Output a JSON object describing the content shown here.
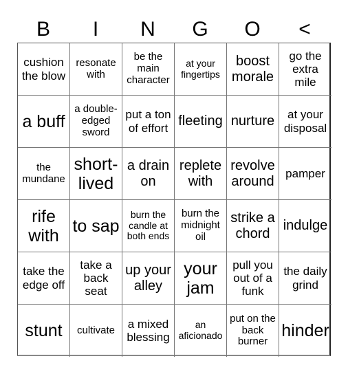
{
  "header": {
    "letters": [
      "B",
      "I",
      "N",
      "G",
      "O",
      "<"
    ]
  },
  "board": {
    "cells": [
      {
        "text": "cushion the blow",
        "size": "m"
      },
      {
        "text": "resonate with",
        "size": "s"
      },
      {
        "text": "be the main character",
        "size": "s"
      },
      {
        "text": "at your fingertips",
        "size": "xs"
      },
      {
        "text": "boost morale",
        "size": "l"
      },
      {
        "text": "go the extra mile",
        "size": "m"
      },
      {
        "text": "a buff",
        "size": "xl"
      },
      {
        "text": "a double-edged sword",
        "size": "s"
      },
      {
        "text": "put a ton of effort",
        "size": "m"
      },
      {
        "text": "fleeting",
        "size": "l"
      },
      {
        "text": "nurture",
        "size": "l"
      },
      {
        "text": "at your disposal",
        "size": "m"
      },
      {
        "text": "the mundane",
        "size": "s"
      },
      {
        "text": "short-lived",
        "size": "xl"
      },
      {
        "text": "a drain on",
        "size": "l"
      },
      {
        "text": "replete with",
        "size": "l"
      },
      {
        "text": "revolve around",
        "size": "l"
      },
      {
        "text": "pamper",
        "size": "m"
      },
      {
        "text": "rife with",
        "size": "xl"
      },
      {
        "text": "to sap",
        "size": "xl"
      },
      {
        "text": "burn the candle at both ends",
        "size": "xs"
      },
      {
        "text": "burn the midnight oil",
        "size": "s"
      },
      {
        "text": "strike a chord",
        "size": "l"
      },
      {
        "text": "indulge",
        "size": "l"
      },
      {
        "text": "take the edge off",
        "size": "m"
      },
      {
        "text": "take a back seat",
        "size": "m"
      },
      {
        "text": "up your alley",
        "size": "l"
      },
      {
        "text": "your jam",
        "size": "xl"
      },
      {
        "text": "pull you out of a funk",
        "size": "m"
      },
      {
        "text": "the daily grind",
        "size": "m"
      },
      {
        "text": "stunt",
        "size": "xl"
      },
      {
        "text": "cultivate",
        "size": "s"
      },
      {
        "text": "a mixed blessing",
        "size": "m"
      },
      {
        "text": "an aficionado",
        "size": "xs"
      },
      {
        "text": "put on the back burner",
        "size": "s"
      },
      {
        "text": "hinder",
        "size": "xl"
      }
    ]
  }
}
